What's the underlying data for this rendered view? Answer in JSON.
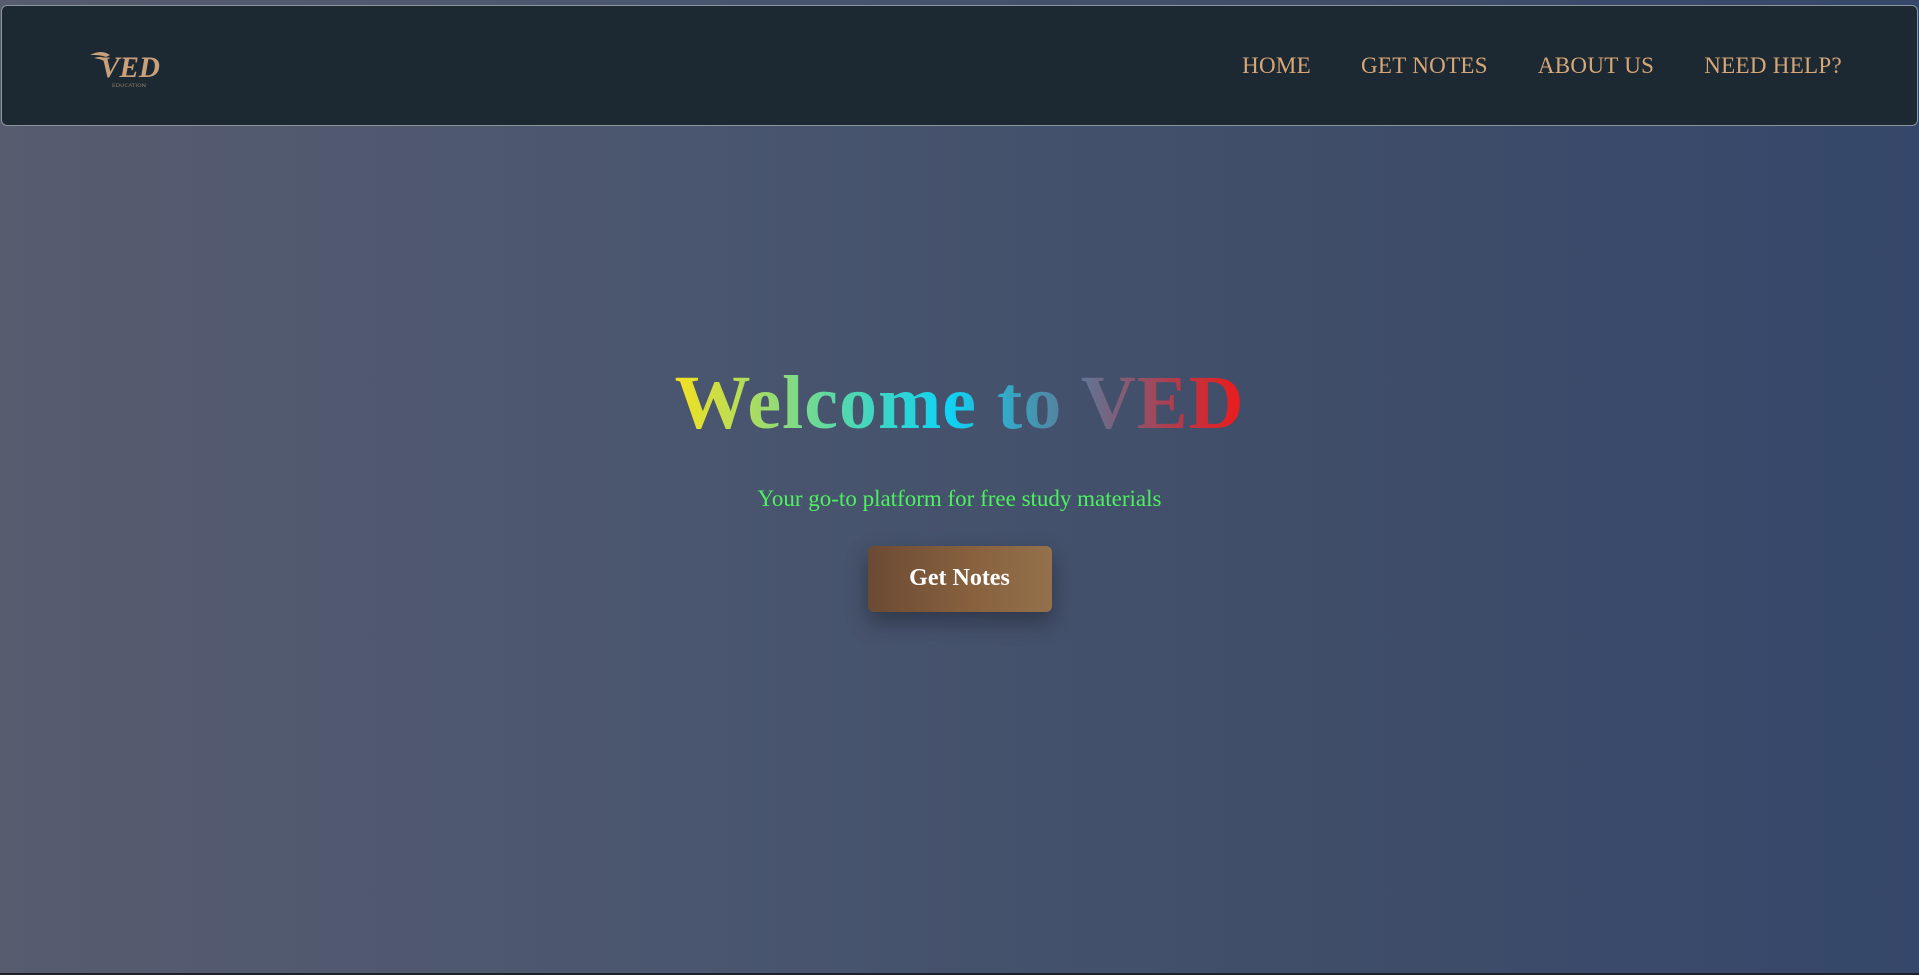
{
  "navbar": {
    "logo": {
      "text": "VED",
      "tagline": "EDUCATION",
      "icon": "ved-logo-icon",
      "color": "#c9a07a"
    },
    "links": [
      {
        "label": "HOME"
      },
      {
        "label": "GET NOTES"
      },
      {
        "label": "ABOUT US"
      },
      {
        "label": "NEED HELP?"
      }
    ]
  },
  "hero": {
    "title": "Welcome to VED",
    "subtitle": "Your go-to platform for free study materials",
    "button_label": "Get Notes"
  },
  "colors": {
    "navbar_bg": "#1c2932",
    "nav_link": "#d8a777",
    "subtitle": "#4cf25e",
    "button_start": "#6b4a34",
    "button_end": "#94704b"
  }
}
